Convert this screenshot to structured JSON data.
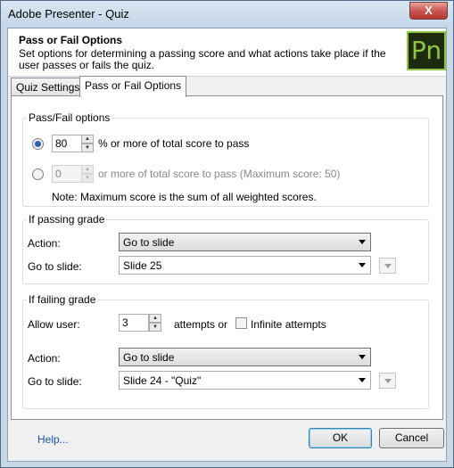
{
  "window": {
    "title": "Adobe Presenter - Quiz",
    "close_symbol": "X"
  },
  "header": {
    "title": "Pass or Fail Options",
    "description": "Set options for determining a passing score and what actions take place if the user passes or fails the quiz.",
    "logo_text": "Pn"
  },
  "tabs": [
    {
      "label": "Quiz Settings",
      "active": false
    },
    {
      "label": "Pass or Fail Options",
      "active": true
    }
  ],
  "pass_fail": {
    "group_label": "Pass/Fail options",
    "percent_value": "80",
    "percent_suffix": "% or more of total score to pass",
    "score_value": "0",
    "score_suffix": "or more of total score to pass (Maximum score: 50)",
    "note": "Note: Maximum score is the sum of all weighted scores."
  },
  "passing": {
    "group_label": "If passing grade",
    "action_label": "Action:",
    "action_value": "Go to slide",
    "goto_label": "Go to slide:",
    "goto_value": "Slide 25"
  },
  "failing": {
    "group_label": "If failing grade",
    "allow_label": "Allow user:",
    "attempts_value": "3",
    "attempts_suffix": "attempts or",
    "infinite_label": "Infinite attempts",
    "action_label": "Action:",
    "action_value": "Go to slide",
    "goto_label": "Go to slide:",
    "goto_value": "Slide 24 - \"Quiz\""
  },
  "footer": {
    "help_label": "Help...",
    "ok_label": "OK",
    "cancel_label": "Cancel"
  }
}
